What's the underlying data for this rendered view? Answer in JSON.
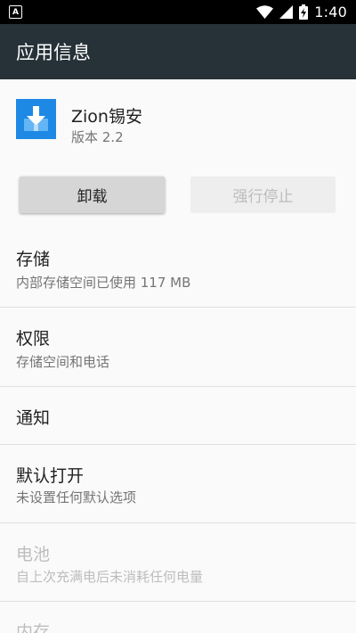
{
  "status_bar": {
    "time": "1:40",
    "left_icon_letter": "A"
  },
  "app_bar": {
    "title": "应用信息"
  },
  "app": {
    "name": "Zion锡安",
    "version": "版本 2.2",
    "icon_color": "#1e88e5"
  },
  "buttons": {
    "uninstall": "卸载",
    "force_stop": "强行停止"
  },
  "items": [
    {
      "title": "存储",
      "subtitle": "内部存储空间已使用 117 MB",
      "enabled": true
    },
    {
      "title": "权限",
      "subtitle": "存储空间和电话",
      "enabled": true
    },
    {
      "title": "通知",
      "subtitle": "",
      "enabled": true
    },
    {
      "title": "默认打开",
      "subtitle": "未设置任何默认选项",
      "enabled": true
    },
    {
      "title": "电池",
      "subtitle": "自上次充满电后未消耗任何电量",
      "enabled": false
    },
    {
      "title": "内存",
      "subtitle": "",
      "enabled": false
    }
  ]
}
